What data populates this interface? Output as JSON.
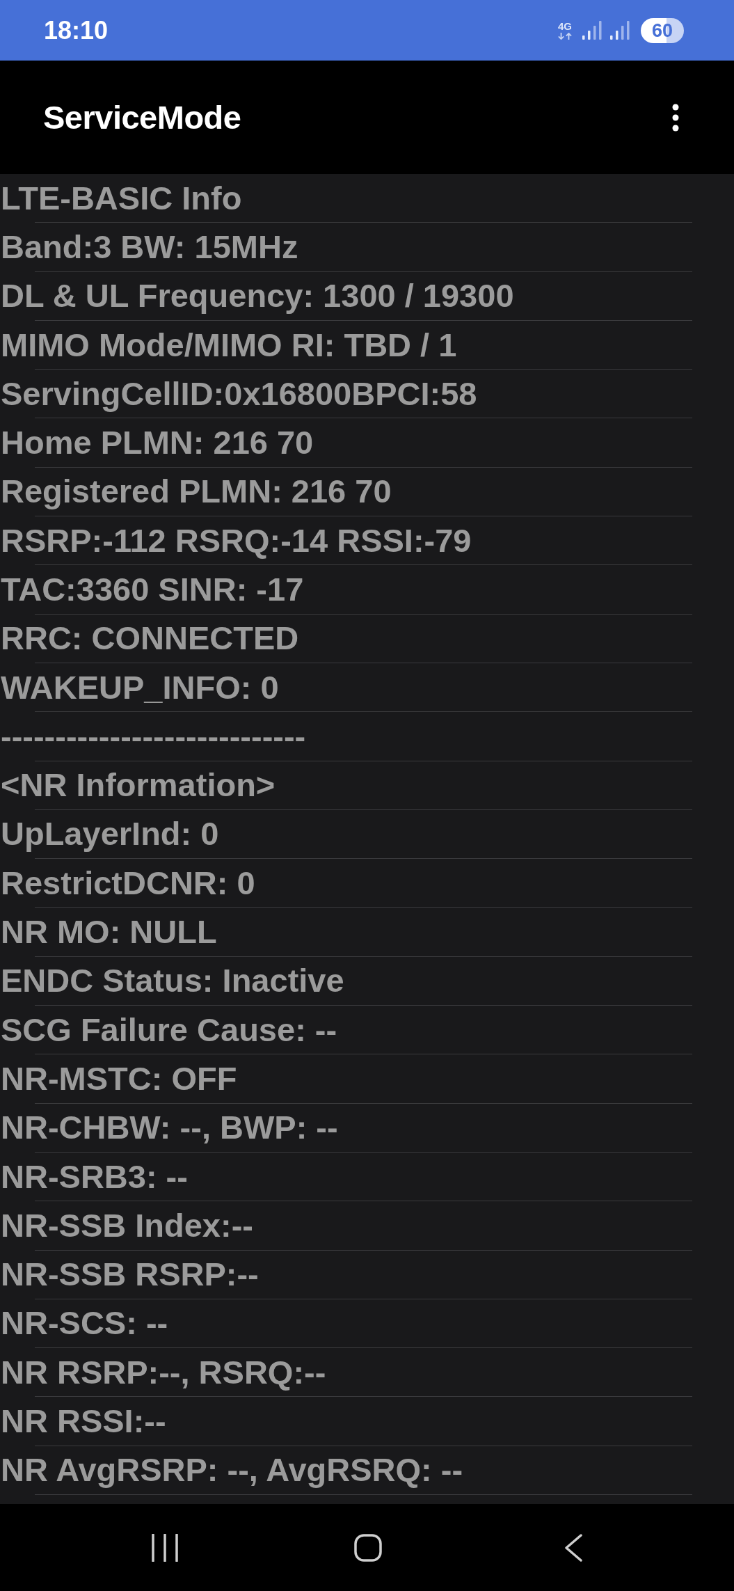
{
  "status_bar": {
    "time": "18:10",
    "network_type": "4G",
    "battery": "60"
  },
  "app_bar": {
    "title": "ServiceMode"
  },
  "info_lines": [
    "LTE-BASIC Info",
    "Band:3 BW: 15MHz",
    "DL & UL Frequency: 1300 / 19300",
    "MIMO Mode/MIMO RI: TBD / 1",
    "ServingCellID:0x16800BPCI:58",
    "Home PLMN: 216 70",
    "Registered PLMN: 216 70",
    "RSRP:-112 RSRQ:-14 RSSI:-79",
    "TAC:3360 SINR: -17",
    "RRC: CONNECTED",
    "WAKEUP_INFO: 0",
    "----------------------------",
    "<NR Information>",
    "UpLayerInd: 0",
    "RestrictDCNR: 0",
    "NR MO: NULL",
    "ENDC Status: Inactive",
    "SCG Failure Cause: --",
    "NR-MSTC: OFF",
    "NR-CHBW: --, BWP: --",
    "NR-SRB3: --",
    "NR-SSB Index:--",
    "NR-SSB RSRP:--",
    "NR-SCS: --",
    "NR RSRP:--, RSRQ:--",
    "NR RSSI:--",
    "NR AvgRSRP: --, AvgRSRQ: --"
  ]
}
